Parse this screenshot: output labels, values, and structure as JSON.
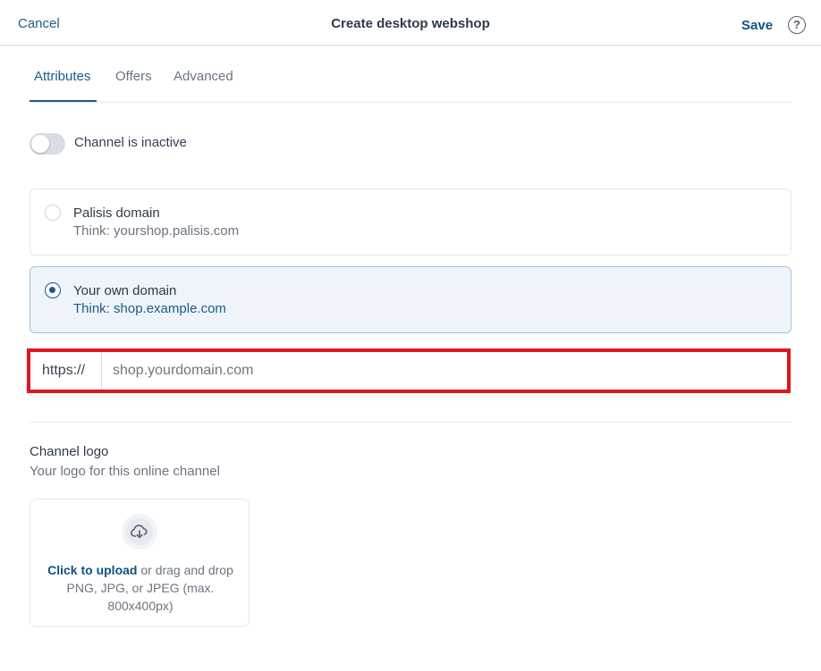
{
  "header": {
    "cancel_label": "Cancel",
    "title": "Create desktop webshop",
    "save_label": "Save",
    "help_glyph": "?"
  },
  "tabs": [
    {
      "label": "Attributes",
      "active": true
    },
    {
      "label": "Offers",
      "active": false
    },
    {
      "label": "Advanced",
      "active": false
    }
  ],
  "channel_status": {
    "label": "Channel is inactive",
    "active": false
  },
  "domain_options": [
    {
      "title": "Palisis domain",
      "subtitle": "Think: yourshop.palisis.com",
      "selected": false
    },
    {
      "title": "Your own domain",
      "subtitle": "Think: shop.example.com",
      "selected": true
    }
  ],
  "url_field": {
    "prefix": "https://",
    "placeholder": "shop.yourdomain.com",
    "value": ""
  },
  "logo": {
    "title": "Channel logo",
    "subtitle": "Your logo for this online channel",
    "upload_link": "Click to upload",
    "upload_rest": " or drag and drop PNG, JPG, or JPEG (max. 800x400px)",
    "icon": "cloud-download-icon"
  },
  "colors": {
    "accent": "#1d5a8c",
    "highlight_border": "#e0161d",
    "selected_card_bg": "#eef4f9"
  }
}
